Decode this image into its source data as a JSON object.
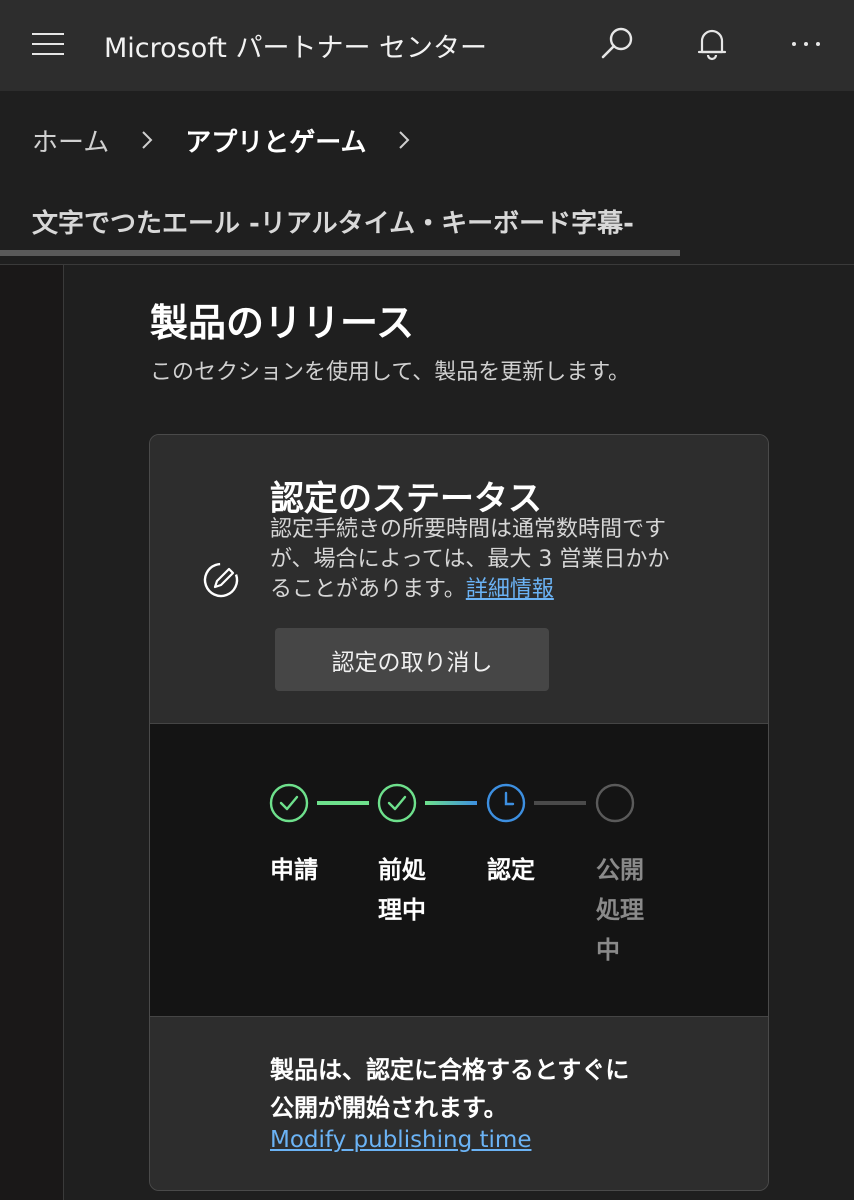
{
  "header": {
    "app_title": "Microsoft パートナー センター"
  },
  "breadcrumb": {
    "home": "ホーム",
    "current": "アプリとゲーム"
  },
  "product_tab": "文字でつたエール -リアルタイム・キーボード字幕-",
  "section": {
    "title": "製品のリリース",
    "description": "このセクションを使用して、製品を更新します。"
  },
  "certification": {
    "title": "認定のステータス",
    "text": "認定手続きの所要時間は通常数時間ですが、場合によっては、最大 3 営業日かかることがあります。",
    "link": "詳細情報",
    "cancel_button": "認定の取り消し"
  },
  "steps": [
    {
      "label": "申請",
      "state": "done"
    },
    {
      "label": "前処理中",
      "state": "done"
    },
    {
      "label": "認定",
      "state": "current"
    },
    {
      "label": "公開処理中",
      "state": "pending"
    }
  ],
  "publish": {
    "text": "製品は、認定に合格するとすぐに公開が開始されます。",
    "link": "Modify publishing time"
  },
  "colors": {
    "done": "#6ee08c",
    "current": "#3d8fe0",
    "pending": "#5a5a5a",
    "link": "#6bb3f5"
  }
}
